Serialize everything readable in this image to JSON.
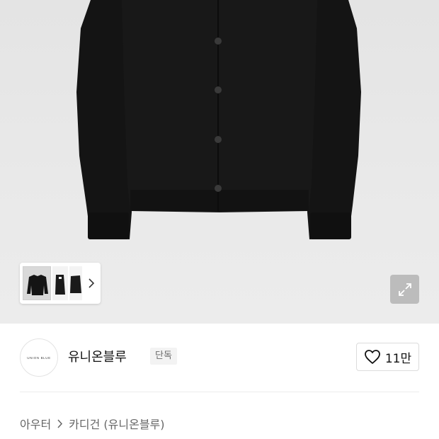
{
  "product_image": {
    "alt": "black knit cardigan"
  },
  "thumbnails": [
    {
      "icon": "cardigan-front-thumbnail"
    },
    {
      "icon": "cardigan-side-thumbnail"
    },
    {
      "icon": "cardigan-back-thumbnail"
    }
  ],
  "brand": {
    "logo_text": "UNION BLUE",
    "name": "유니온블루",
    "badge": "단독"
  },
  "like": {
    "count": "11만"
  },
  "breadcrumb": {
    "level1": "아우터",
    "level2": "카디건 (유니온블루)"
  },
  "colors": {
    "background": "#ffffff",
    "image_backdrop": "#e7e7e7",
    "garment": "#141414",
    "badge_bg": "#f3f3f3"
  }
}
